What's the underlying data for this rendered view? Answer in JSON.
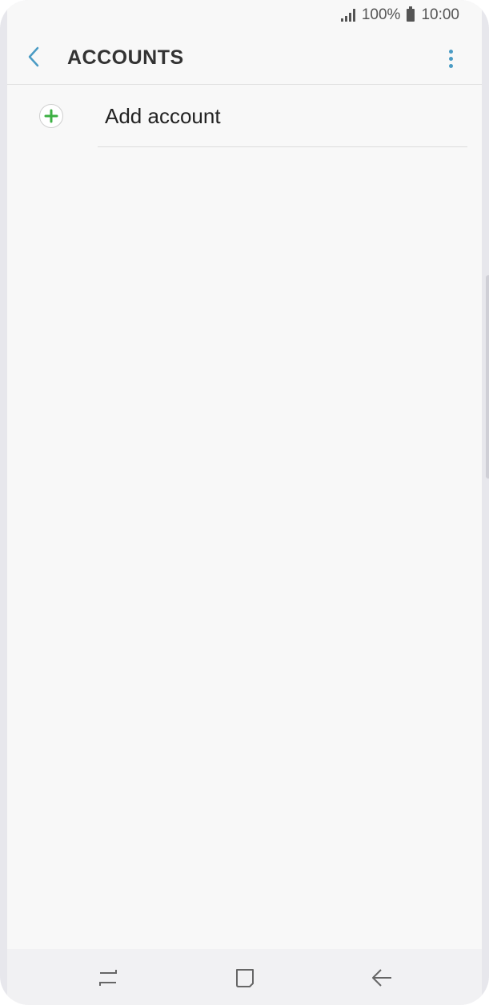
{
  "status_bar": {
    "battery_text": "100%",
    "time": "10:00",
    "icons": [
      "signal-icon",
      "battery-icon"
    ]
  },
  "app_bar": {
    "title": "ACCOUNTS",
    "back_icon": "chevron-left-icon",
    "menu_icon": "more-vertical-icon",
    "accent_color": "#4a9bc4"
  },
  "list": {
    "items": [
      {
        "label": "Add account",
        "icon": "plus-circle-icon",
        "icon_color": "#3cb043"
      }
    ]
  },
  "nav_bar": {
    "icons": [
      "recent-apps-icon",
      "home-icon",
      "back-arrow-icon"
    ]
  }
}
